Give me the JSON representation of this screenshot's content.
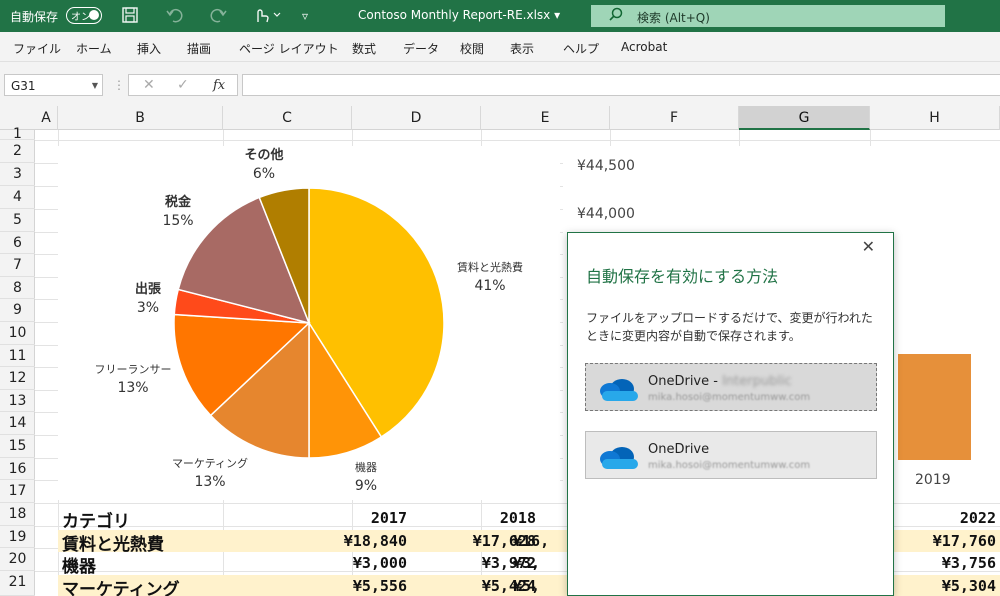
{
  "titlebar": {
    "autosave_label": "自動保存",
    "autosave_toggle": "オン",
    "document_title": "Contoso Monthly Report-RE.xlsx",
    "title_dropdown": "▾",
    "search_placeholder": "検索 (Alt+Q)",
    "icons": [
      "save-icon",
      "undo-icon",
      "redo-icon",
      "touch-mode-icon",
      "customize-icon",
      "search-icon"
    ]
  },
  "menu": [
    "ファイル",
    "ホーム",
    "挿入",
    "描画",
    "ページ レイアウト",
    "数式",
    "データ",
    "校閲",
    "表示",
    "ヘルプ",
    "Acrobat"
  ],
  "formula_bar": {
    "name_box": "G31",
    "formula": ""
  },
  "columns": [
    "A",
    "B",
    "C",
    "D",
    "E",
    "F",
    "G",
    "H"
  ],
  "rows": [
    "1",
    "2",
    "3",
    "4",
    "5",
    "6",
    "7",
    "8",
    "9",
    "10",
    "11",
    "12",
    "13",
    "14",
    "15",
    "16",
    "17",
    "18",
    "19",
    "20",
    "21"
  ],
  "chart_data": [
    {
      "type": "pie",
      "categories": [
        "賃料と光熱費",
        "機器",
        "マーケティング",
        "フリーランサー",
        "出張",
        "税金",
        "その他"
      ],
      "values": [
        41,
        9,
        13,
        13,
        3,
        15,
        6
      ],
      "colors": [
        "#ffc000",
        "#ff9407",
        "#e6862e",
        "#ff7600",
        "#ff4a1a",
        "#a86a64",
        "#b07e00"
      ],
      "percent_labels": [
        "41%",
        "9%",
        "13%",
        "13%",
        "3%",
        "15%",
        "6%"
      ]
    },
    {
      "type": "bar",
      "categories": [
        "2019"
      ],
      "y_tick_labels": [
        "¥44,500",
        "¥44,000"
      ],
      "visible_categories": [
        "2019"
      ],
      "bar_color": "#e6903a"
    }
  ],
  "table": {
    "header": {
      "label": "カテゴリ",
      "y2017": "2017",
      "y2018": "2018",
      "y2022": "2022"
    },
    "rows": [
      {
        "label": "賃料と光熱費",
        "c": "¥18,840",
        "d": "¥17,628",
        "e": "¥16,",
        "h": "¥17,760"
      },
      {
        "label": "機器",
        "c": "¥3,000",
        "d": "¥3,972",
        "e": "¥3,",
        "h": "¥3,756"
      },
      {
        "label": "マーケティング",
        "c": "¥5,556",
        "d": "¥5,424",
        "e": "¥5,",
        "h": "¥5,304"
      }
    ]
  },
  "popup": {
    "close": "✕",
    "title": "自動保存を有効にする方法",
    "description": "ファイルをアップロードするだけで、変更が行われたときに変更内容が自動で保存されます。",
    "accounts": [
      {
        "name": "OneDrive - ",
        "org": "Interpublic",
        "email": "mika.hosoi@momentumww.com"
      },
      {
        "name": "OneDrive",
        "org": "",
        "email": "mika.hosoi@momentumww.com"
      }
    ]
  }
}
